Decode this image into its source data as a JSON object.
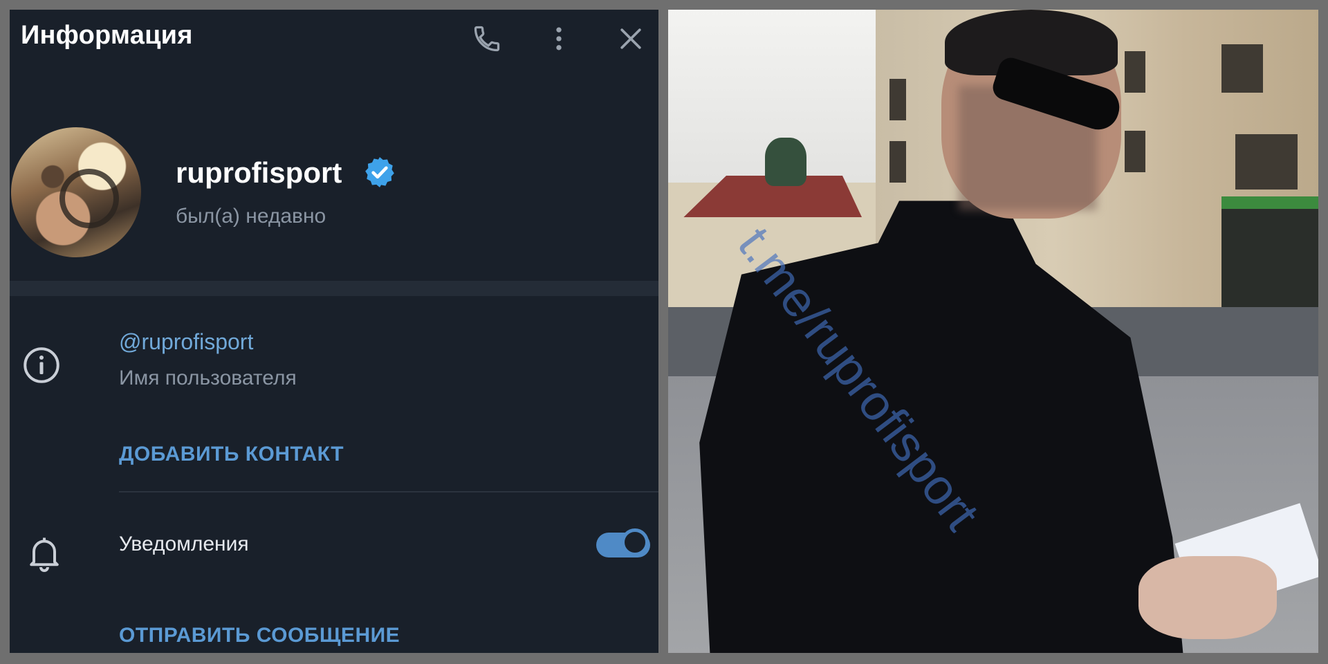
{
  "header": {
    "title": "Информация",
    "icons": [
      "phone-icon",
      "more-vertical-icon",
      "close-icon"
    ]
  },
  "profile": {
    "name": "ruprofisport",
    "status": "был(а) недавно",
    "verified": true
  },
  "info": {
    "username": "@ruprofisport",
    "username_label": "Имя пользователя",
    "add_contact": "ДОБАВИТЬ КОНТАКТ"
  },
  "notifications": {
    "label": "Уведомления",
    "enabled": true
  },
  "actions": {
    "send_message": "ОТПРАВИТЬ СООБЩЕНИЕ"
  },
  "photo": {
    "watermark": "t.me/ruprofisport"
  },
  "colors": {
    "panel_bg": "#19202a",
    "accent": "#5b9ad4",
    "muted_text": "#8a95a3",
    "toggle_on": "#4f8ac6"
  }
}
